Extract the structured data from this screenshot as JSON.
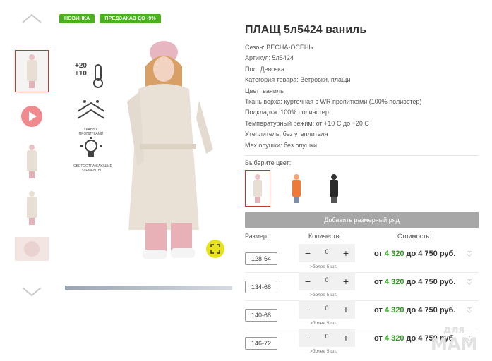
{
  "badges": {
    "new": "НОВИНКА",
    "preorder": "ПРЕДЗАКАЗ ДО -9%"
  },
  "product": {
    "title": "ПЛАЩ 5л5424 ваниль",
    "attributes": [
      "Сезон: ВЕСНА-ОСЕНЬ",
      "Артикул: 5л5424",
      "Пол: Девочка",
      "Категория товара: Ветровки, плащи",
      "Цвет: ваниль",
      "Ткань верха: курточная с WR пропитками (100% полиэстер)",
      "Подкладка: 100% полиэстер",
      "Температурный режим: от +10 С до +20 С",
      "Утеплитель: без утеплителя",
      "Мех опушки: без опушки"
    ]
  },
  "photo": {
    "temp_top": "+20",
    "temp_bottom": "+10",
    "fabric_label": "ТКАНЬ С ПРОПИТКАМИ",
    "reflective_label": "СВЕТООТРАЖАЮЩИЕ ЭЛЕМЕНТЫ"
  },
  "colors": {
    "label": "Выберите цвет:",
    "options": [
      "ваниль",
      "оранжевый",
      "черный"
    ]
  },
  "add_row_button": "Добавить размерный ряд",
  "table": {
    "headers": {
      "size": "Размер:",
      "qty": "Количество:",
      "cost": "Стоимость:"
    },
    "rows": [
      {
        "size": "128-64",
        "qty": "0",
        "more": ">более 5 шт.",
        "price_prefix": "от",
        "price_min": "4 320",
        "price_mid": "до 4 750 руб."
      },
      {
        "size": "134-68",
        "qty": "0",
        "more": ">более 5 шт.",
        "price_prefix": "от",
        "price_min": "4 320",
        "price_mid": "до 4 750 руб."
      },
      {
        "size": "140-68",
        "qty": "0",
        "more": ">более 5 шт.",
        "price_prefix": "от",
        "price_min": "4 320",
        "price_mid": "до 4 750 руб."
      },
      {
        "size": "146-72",
        "qty": "0",
        "more": ">более 5 шт.",
        "price_prefix": "от",
        "price_min": "4 320",
        "price_mid": "до 4 750 руб."
      }
    ],
    "minus": "−",
    "plus": "+",
    "heart": "♡"
  },
  "watermark": {
    "top": "для",
    "bottom": "МАМ"
  },
  "colors_hex": {
    "accent_green": "#4caf1f",
    "price_green": "#2a9b1a",
    "active_border": "#c0392b",
    "button_gray": "#a7a7a7"
  }
}
